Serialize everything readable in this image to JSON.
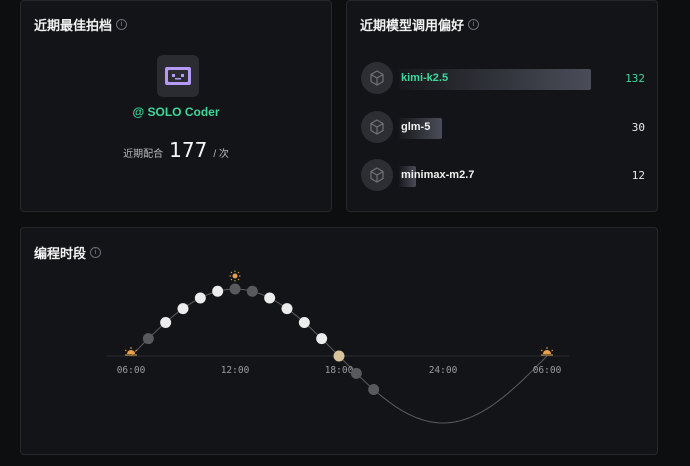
{
  "partner": {
    "title": "近期最佳拍档",
    "name": "@ SOLO Coder",
    "stat_label": "近期配合",
    "stat_value": "177",
    "stat_unit": "/ 次",
    "accent": "#3fd89b",
    "avatar_icon": "robot-face-icon"
  },
  "models": {
    "title": "近期模型调用偏好",
    "items": [
      {
        "name": "kimi-k2.5",
        "count": "132",
        "value": 132,
        "active": true
      },
      {
        "name": "glm-5",
        "count": "30",
        "value": 30,
        "active": false
      },
      {
        "name": "minimax-m2.7",
        "count": "12",
        "value": 12,
        "active": false
      }
    ]
  },
  "timeline": {
    "title": "编程时段",
    "ticks": [
      "06:00",
      "12:00",
      "18:00",
      "24:00",
      "06:00"
    ],
    "sunrise_icon": "sunrise-icon",
    "noon_icon": "sun-icon",
    "sunset_icon": "sunrise-icon",
    "night_icon": "moon-icon",
    "activity": [
      {
        "hour": 7,
        "level": "dim"
      },
      {
        "hour": 8,
        "level": "bright"
      },
      {
        "hour": 9,
        "level": "bright"
      },
      {
        "hour": 10,
        "level": "bright"
      },
      {
        "hour": 11,
        "level": "bright"
      },
      {
        "hour": 12,
        "level": "dim"
      },
      {
        "hour": 13,
        "level": "dim"
      },
      {
        "hour": 14,
        "level": "bright"
      },
      {
        "hour": 15,
        "level": "bright"
      },
      {
        "hour": 16,
        "level": "bright"
      },
      {
        "hour": 17,
        "level": "bright"
      },
      {
        "hour": 18,
        "level": "sunset"
      },
      {
        "hour": 19,
        "level": "dim"
      },
      {
        "hour": 20,
        "level": "dim"
      }
    ]
  }
}
